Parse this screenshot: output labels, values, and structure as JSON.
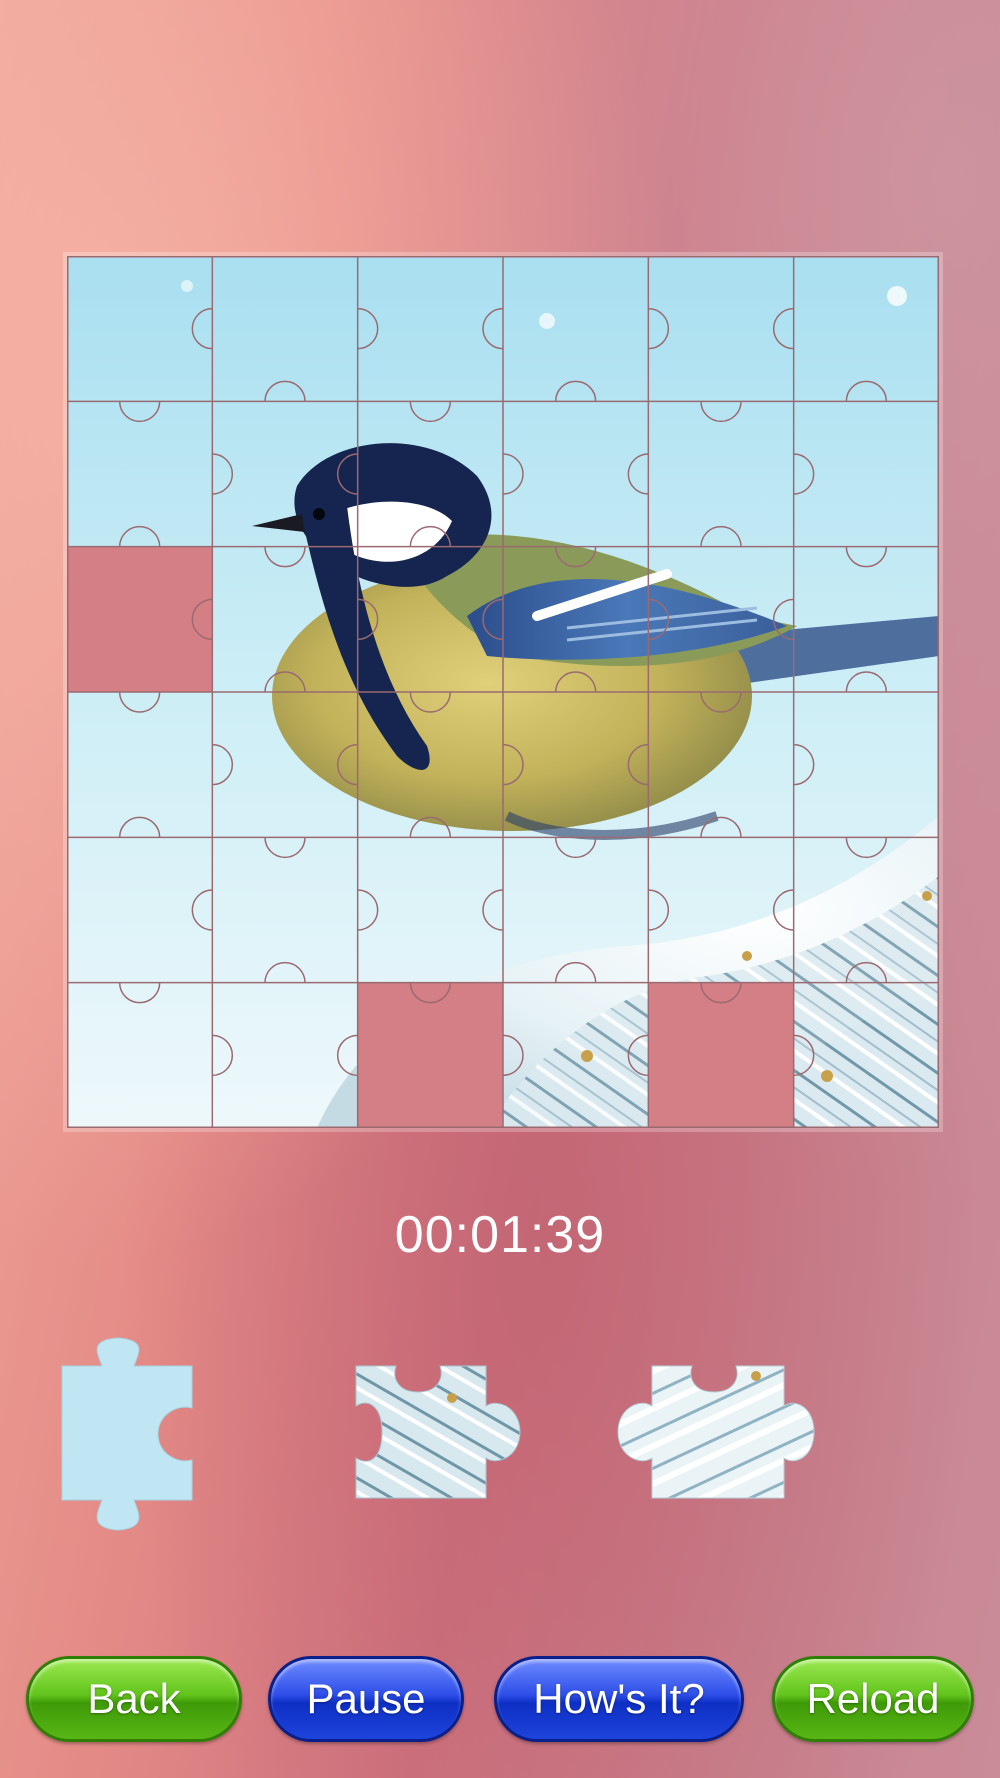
{
  "game": {
    "timer": "00:01:39",
    "grid": {
      "rows": 6,
      "cols": 6
    },
    "missing_slots": [
      {
        "row": 2,
        "col": 0
      },
      {
        "row": 5,
        "col": 2
      },
      {
        "row": 5,
        "col": 4
      }
    ],
    "tray_pieces": [
      {
        "name": "tray-piece-sky"
      },
      {
        "name": "tray-piece-pine-branch"
      },
      {
        "name": "tray-piece-snowy-pine"
      }
    ]
  },
  "buttons": {
    "back": "Back",
    "pause": "Pause",
    "hows_it": "How's It?",
    "reload": "Reload"
  },
  "colors": {
    "button_green": "#5cbf16",
    "button_blue": "#1d44dc",
    "slot_fill": "#d47f86",
    "piece_outline": "#9a6a70"
  }
}
